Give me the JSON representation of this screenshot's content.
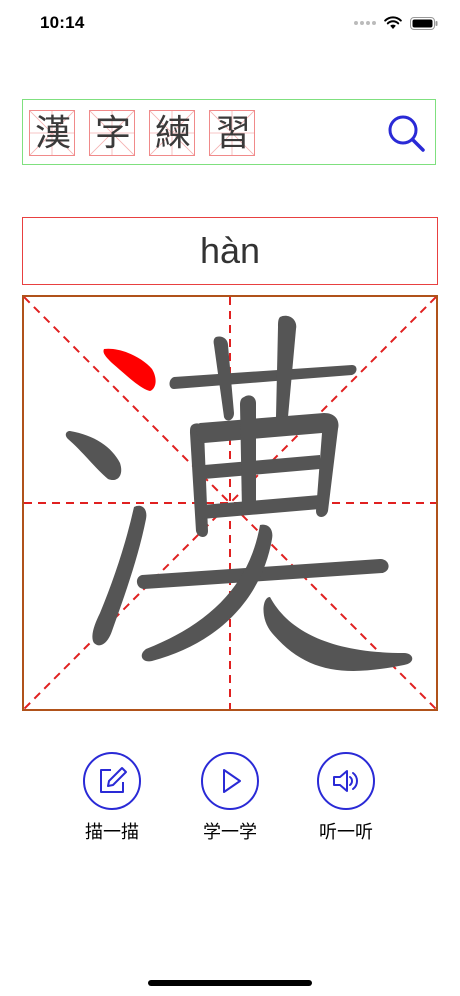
{
  "status_bar": {
    "time": "10:14"
  },
  "search": {
    "characters": [
      "漢",
      "字",
      "練",
      "習"
    ],
    "button_icon": "magnifier-icon"
  },
  "pinyin": "hàn",
  "main_character": {
    "character": "漢",
    "highlight_color": "#ff0000",
    "stroke_color": "#555555",
    "guide_color": "#e02020"
  },
  "actions": [
    {
      "label": "描一描",
      "icon": "trace-edit-icon"
    },
    {
      "label": "学一学",
      "icon": "play-icon"
    },
    {
      "label": "听一听",
      "icon": "speaker-icon"
    }
  ],
  "colors": {
    "accent": "#2a2ad6",
    "search_border": "#7fe07f",
    "pinyin_border": "#e84040",
    "canvas_border": "#b0521a"
  }
}
